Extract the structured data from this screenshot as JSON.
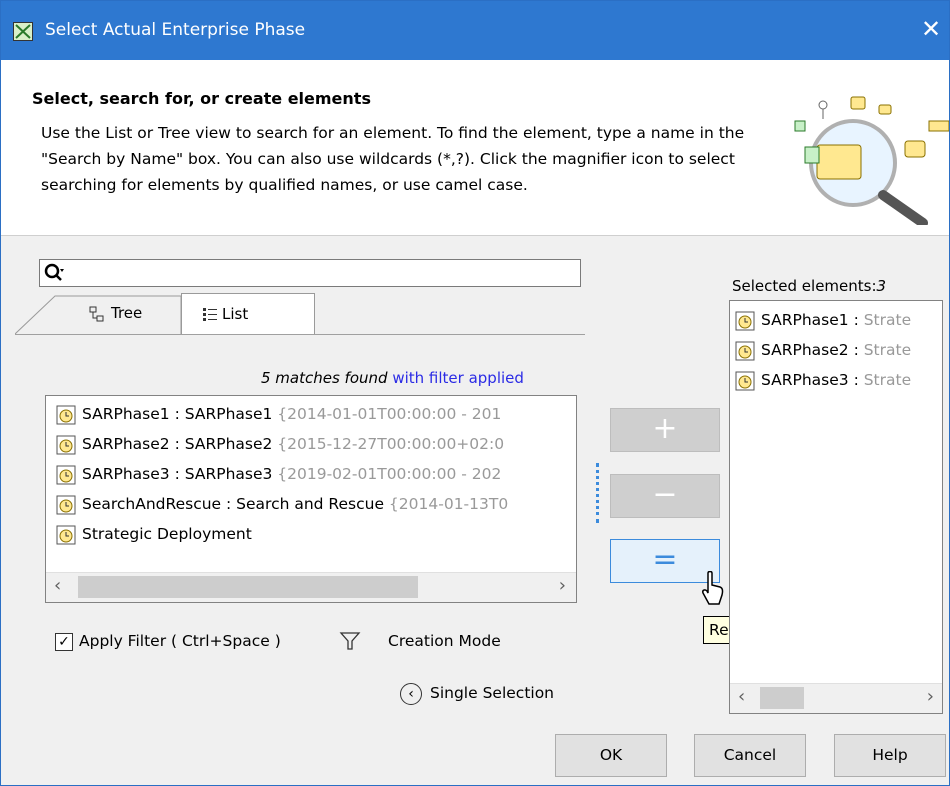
{
  "window": {
    "title": "Select Actual Enterprise Phase",
    "close_glyph": "✕"
  },
  "header": {
    "heading": "Select, search for, or create elements",
    "description": "Use the List or Tree view to search for an element. To find the element, type a name in the \"Search by Name\" box. You can also use wildcards (*,?). Click the magnifier icon to select searching for elements by qualified names, or use camel case."
  },
  "search": {
    "value": "",
    "icon": "magnifier-icon"
  },
  "tabs": [
    {
      "label": "Tree",
      "active": false
    },
    {
      "label": "List",
      "active": true
    }
  ],
  "matches": {
    "count_text": "5 matches found",
    "filter_text": " with filter applied"
  },
  "list": {
    "items": [
      {
        "name": "SARPhase1 : SARPhase1",
        "detail": " {2014-01-01T00:00:00 - 201"
      },
      {
        "name": "SARPhase2 : SARPhase2",
        "detail": " {2015-12-27T00:00:00+02:0"
      },
      {
        "name": "SARPhase3 : SARPhase3",
        "detail": " {2019-02-01T00:00:00 - 202"
      },
      {
        "name": "SearchAndRescue : Search and Rescue",
        "detail": " {2014-01-13T0"
      },
      {
        "name": "Strategic Deployment",
        "detail": ""
      }
    ]
  },
  "move_buttons": {
    "add": "+",
    "remove": "−",
    "remove_all": "="
  },
  "tooltip": "Remove All",
  "filter": {
    "label": "Apply Filter ( Ctrl+Space )",
    "checked": true,
    "check_glyph": "✓"
  },
  "creation_mode": "Creation Mode",
  "single_selection": "Single Selection",
  "selected": {
    "label": "Selected elements:",
    "count": "3",
    "items": [
      {
        "name": "SARPhase1 : ",
        "detail": "Strate"
      },
      {
        "name": "SARPhase2 : ",
        "detail": "Strate"
      },
      {
        "name": "SARPhase3 : ",
        "detail": "Strate"
      }
    ]
  },
  "buttons": {
    "ok": "OK",
    "cancel": "Cancel",
    "help": "Help"
  },
  "colors": {
    "titlebar": "#2e78d0",
    "link_blue": "#2b2be5",
    "accent": "#3c8bdc",
    "tooltip_bg": "#ffffe1"
  }
}
